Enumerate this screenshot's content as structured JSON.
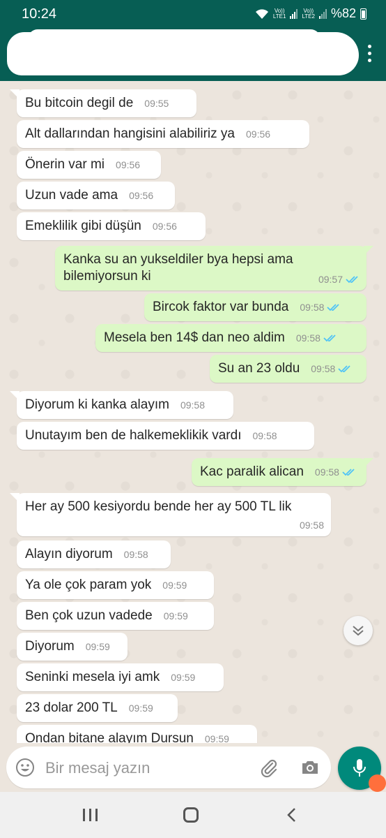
{
  "status_bar": {
    "time": "10:24",
    "sim1": "LTE1",
    "sim1_top": "Vo))",
    "sim2": "LTE2",
    "sim2_top": "Vo))",
    "battery": "%82"
  },
  "input": {
    "placeholder": "Bir mesaj yazın"
  },
  "colors": {
    "header": "#075e54",
    "outgoing_bubble": "#dcf8c6",
    "incoming_bubble": "#ffffff",
    "read_ticks": "#4fc3f7",
    "mic_button": "#00897b"
  },
  "messages": [
    {
      "dir": "in",
      "text": "Bu bitcoin degil de",
      "time": "09:55"
    },
    {
      "dir": "in",
      "text": "Alt dallarından hangisini alabiliriz ya",
      "time": "09:56"
    },
    {
      "dir": "in",
      "text": "Önerin var mi",
      "time": "09:56"
    },
    {
      "dir": "in",
      "text": "Uzun vade ama",
      "time": "09:56"
    },
    {
      "dir": "in",
      "text": "Emeklilik gibi düşün",
      "time": "09:56"
    },
    {
      "dir": "out",
      "text": "Kanka su an yukseldiler bya hepsi ama bilemiyorsun ki",
      "time": "09:57",
      "status": "read"
    },
    {
      "dir": "out",
      "text": "Bircok faktor var bunda",
      "time": "09:58",
      "status": "read"
    },
    {
      "dir": "out",
      "text": "Mesela ben 14$ dan neo aldim",
      "time": "09:58",
      "status": "read"
    },
    {
      "dir": "out",
      "text": "Su an 23 oldu",
      "time": "09:58",
      "status": "read"
    },
    {
      "dir": "in",
      "text": "Diyorum ki kanka alayım",
      "time": "09:58"
    },
    {
      "dir": "in",
      "text": "Unutayım ben de halkemeklikik vardı",
      "time": "09:58"
    },
    {
      "dir": "out",
      "text": "Kac paralik alican",
      "time": "09:58",
      "status": "read"
    },
    {
      "dir": "in",
      "text": "Her ay 500 kesiyordu bende her ay 500 TL lik",
      "time": "09:58"
    },
    {
      "dir": "in",
      "text": "Alayın diyorum",
      "time": "09:58"
    },
    {
      "dir": "in",
      "text": "Ya ole çok param yok",
      "time": "09:59"
    },
    {
      "dir": "in",
      "text": "Ben çok uzun vadede",
      "time": "09:59"
    },
    {
      "dir": "in",
      "text": "Diyorum",
      "time": "09:59"
    },
    {
      "dir": "in",
      "text": "Seninki mesela iyi amk",
      "time": "09:59"
    },
    {
      "dir": "in",
      "text": "23 dolar 200 TL",
      "time": "09:59"
    },
    {
      "dir": "in",
      "text": "Ondan bitane alayım Dursun",
      "time": "09:59"
    }
  ]
}
